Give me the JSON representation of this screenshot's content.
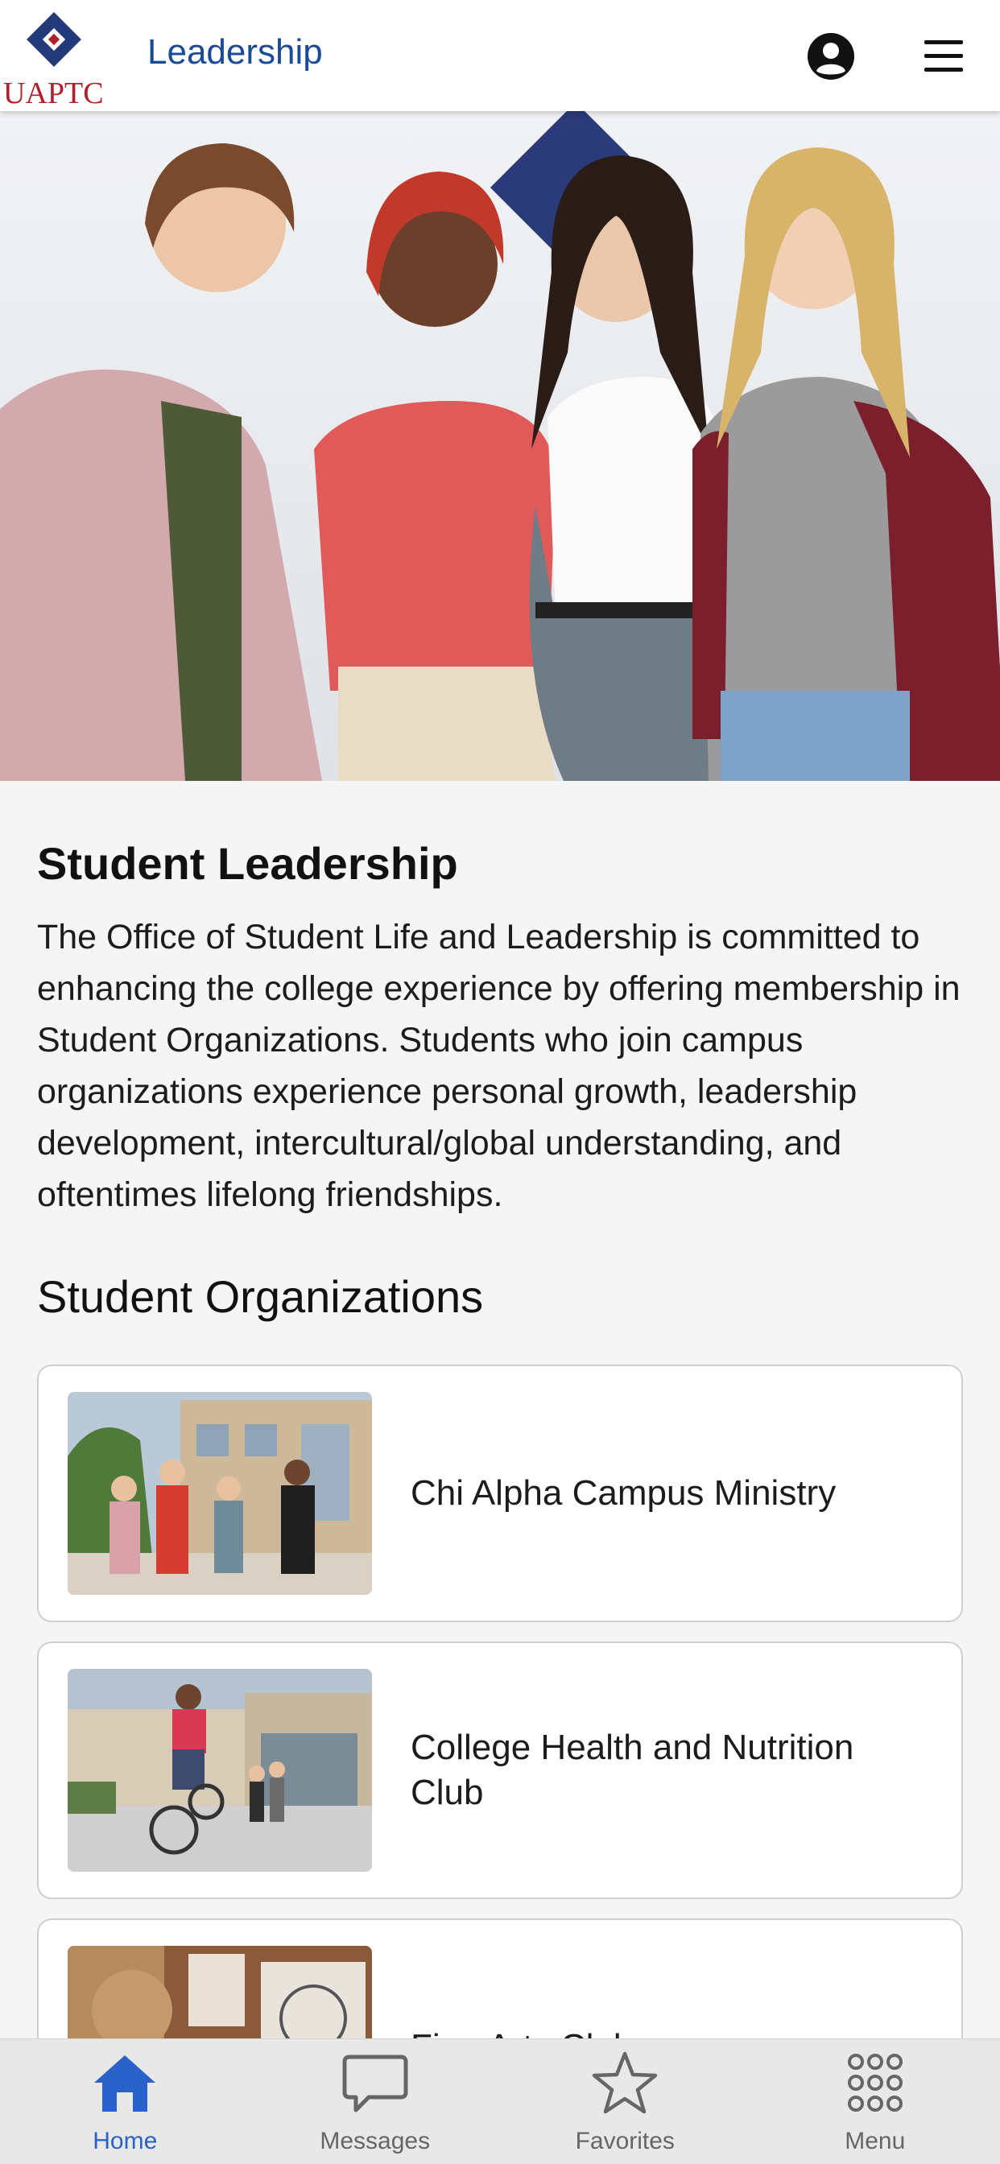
{
  "header": {
    "logo_text": "UAPTC",
    "title": "Leadership",
    "account_icon": "account-circle-icon",
    "menu_icon": "hamburger-menu-icon"
  },
  "hero": {
    "image": "group-photo-four-students"
  },
  "main": {
    "section_title": "Student Leadership",
    "intro": "The Office of Student Life and Leadership is committed to enhancing the college experience by offering membership in Student Organizations. Students who join campus organizations experience personal growth, leadership development, intercultural/global understanding, and oftentimes lifelong friendships.",
    "orgs_title": "Student Organizations",
    "organizations": [
      {
        "name": "Chi Alpha Campus Ministry"
      },
      {
        "name": "College Health and Nutrition Club"
      },
      {
        "name": "Fine Arts Club"
      }
    ]
  },
  "tabbar": {
    "tabs": [
      {
        "label": "Home",
        "icon": "home-icon",
        "active": true
      },
      {
        "label": "Messages",
        "icon": "chat-bubble-icon",
        "active": false
      },
      {
        "label": "Favorites",
        "icon": "star-icon",
        "active": false
      },
      {
        "label": "Menu",
        "icon": "grid-dots-icon",
        "active": false
      }
    ]
  },
  "colors": {
    "brand_navy": "#233a7a",
    "brand_red": "#b0202a",
    "header_title": "#1a4b96",
    "active_tab": "#2962c8"
  }
}
